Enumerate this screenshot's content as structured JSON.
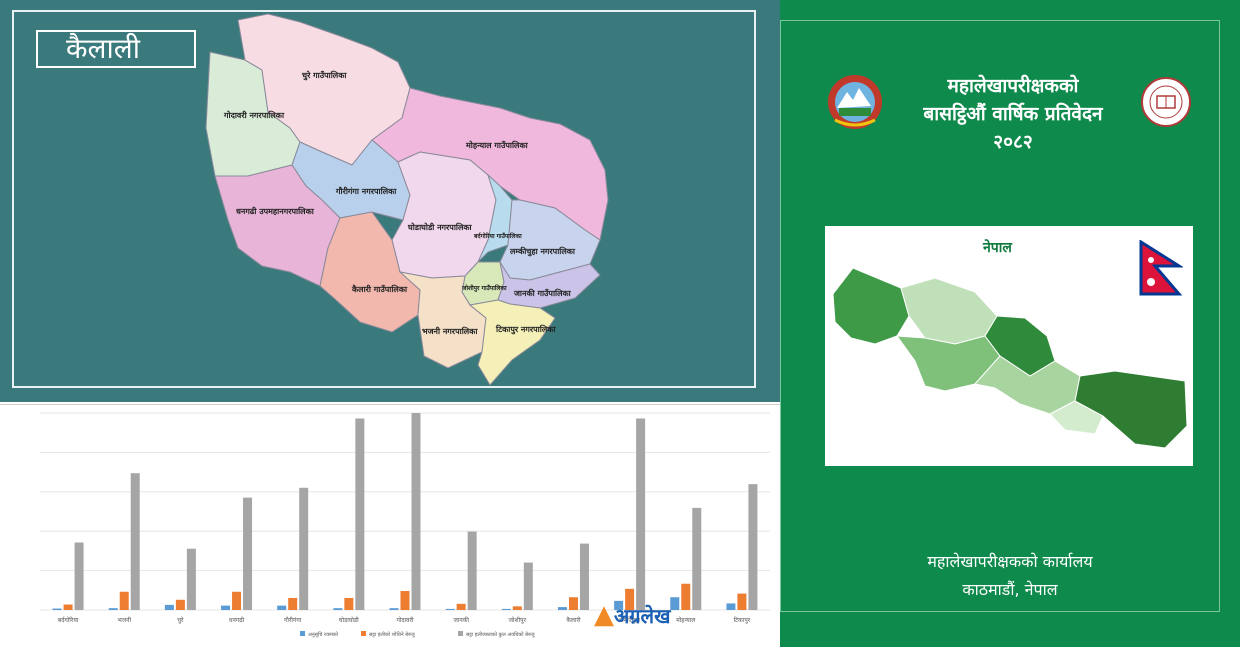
{
  "map": {
    "district": "कैलाली",
    "units": [
      {
        "name": "धनगढी उपमहानगरपालिका",
        "fill": "#e8b4d8"
      },
      {
        "name": "गोदावरी नगरपालिका",
        "fill": "#d8ecd8"
      },
      {
        "name": "गौरीगंगा नगरपालिका",
        "fill": "#b8d0ec"
      },
      {
        "name": "घोडाघोडी नगरपालिका",
        "fill": "#f2d8ec"
      },
      {
        "name": "लम्कीचुहा नगरपालिका",
        "fill": "#c8d4ee"
      },
      {
        "name": "भजनी नगरपालिका",
        "fill": "#f5e0c8"
      },
      {
        "name": "टिकापुर नगरपालिका",
        "fill": "#f4f0b8"
      },
      {
        "name": "बर्दगोरिया गाउँपालिका",
        "fill": "#b8dcee"
      },
      {
        "name": "जोशीपुर गाउँपालिका",
        "fill": "#d8e8b8"
      },
      {
        "name": "जानकी गाउँपालिका",
        "fill": "#ccc4e8"
      },
      {
        "name": "कैलारी गाउँपालिका",
        "fill": "#f2b8ae"
      },
      {
        "name": "चुरे गाउँपालिका",
        "fill": "#f8dce4"
      },
      {
        "name": "मोहन्याल गाउँपालिका",
        "fill": "#f0b8dc"
      }
    ]
  },
  "chart_data": {
    "type": "bar",
    "categories": [
      "बर्दगोरिया",
      "भजनी",
      "चुरे",
      "धनगढी",
      "गौरीगंगा",
      "घोडाघोडी",
      "गोदावरी",
      "जानकी",
      "जोशीपुर",
      "कैलारी",
      "लम्कीचुहा",
      "मोहन्याल",
      "टिकापुर"
    ],
    "series": [
      {
        "name": "अनुसूचि रकमको",
        "color": "#5b9bd5",
        "values": [
          4,
          5,
          14,
          12,
          12,
          5,
          5,
          3,
          3,
          8,
          25,
          35,
          18
        ]
      },
      {
        "name": "सट्टा हलीको शोधिने बेरुजु",
        "color": "#ed7d31",
        "values": [
          15,
          50,
          28,
          50,
          33,
          33,
          52,
          17,
          10,
          35,
          58,
          72,
          45
        ]
      },
      {
        "name": "सट्टा हलीजस्ताको कुल अवधिको बेरुजु",
        "color": "#a5a5a5",
        "values": [
          185,
          375,
          168,
          308,
          335,
          525,
          540,
          215,
          130,
          182,
          525,
          280,
          345
        ]
      }
    ],
    "ylim": [
      0,
      540
    ],
    "grid": true,
    "legend": "bottom"
  },
  "cover": {
    "title_line1": "महालेखापरीक्षकको",
    "title_line2": "बासट्ठिऔं वार्षिक प्रतिवेदन",
    "year": "२०८२",
    "inset_title": "नेपाल",
    "office_line1": "महालेखापरीक्षकको कार्यालय",
    "office_line2": "काठमाडौं, नेपाल"
  },
  "watermark": {
    "text": "अग्रलेख",
    "color": "#1a5fb4"
  }
}
